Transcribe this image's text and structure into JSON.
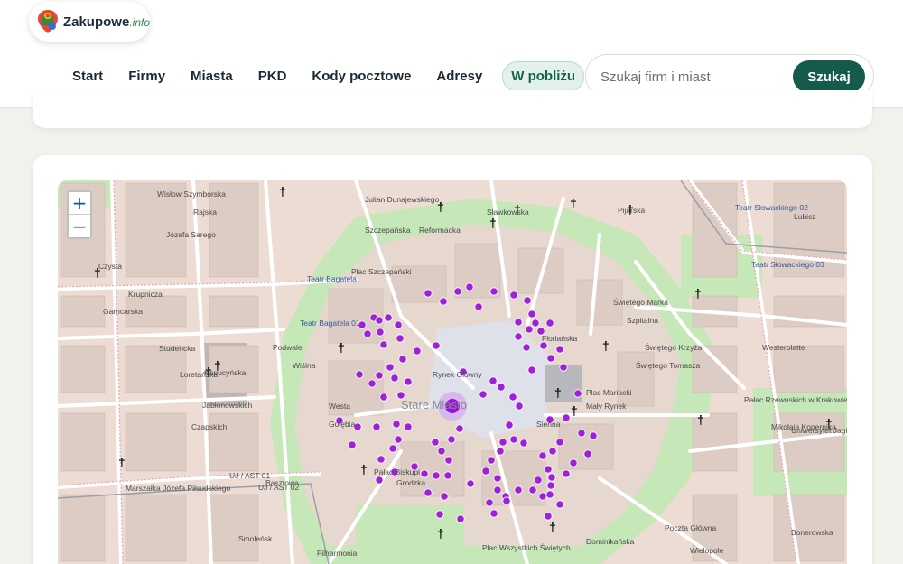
{
  "header": {
    "logo": {
      "brand": "Zakupowe",
      "suffix": ".info"
    },
    "nav": [
      {
        "label": "Start",
        "active": false
      },
      {
        "label": "Firmy",
        "active": false
      },
      {
        "label": "Miasta",
        "active": false
      },
      {
        "label": "PKD",
        "active": false
      },
      {
        "label": "Kody pocztowe",
        "active": false
      },
      {
        "label": "Adresy",
        "active": false
      },
      {
        "label": "W pobliżu",
        "active": true
      }
    ],
    "search": {
      "placeholder": "Szukaj firm i miast",
      "button_label": "Szukaj"
    }
  },
  "map": {
    "zoom_in": "+",
    "zoom_out": "−",
    "center_label": "Stare Miasto",
    "labels": [
      {
        "text": "Teatr Bagatela",
        "color": "blue"
      },
      {
        "text": "Teatr Bagatela 01",
        "color": "blue"
      },
      {
        "text": "Teatr Słowackiego 02",
        "color": "blue"
      },
      {
        "text": "Teatr Słowackiego 03",
        "color": "blue"
      },
      {
        "text": "Pałac Rzewuskich w Krakowie",
        "color": "dark"
      },
      {
        "text": "Uniwersytet Jagielloński Collegium Medicum",
        "color": "dark"
      },
      {
        "text": "Plac Wszystkich Świętych",
        "color": "dark"
      },
      {
        "text": "Pałac Biskupi",
        "color": "dark"
      },
      {
        "text": "Filharmonia",
        "color": "dark"
      },
      {
        "text": "UJ / AST 01",
        "color": "dark"
      },
      {
        "text": "UJ / AST 02",
        "color": "dark"
      },
      {
        "text": "Poczta Główna",
        "color": "dark"
      },
      {
        "text": "Plac Mariacki",
        "color": "dark"
      },
      {
        "text": "Plac Szczepański",
        "color": "dark"
      },
      {
        "text": "Rynek Główny",
        "color": "dark"
      },
      {
        "text": "Czysta",
        "color": "dark"
      },
      {
        "text": "Krupnicza",
        "color": "dark"
      },
      {
        "text": "Studencka",
        "color": "dark"
      },
      {
        "text": "Kapucyńska",
        "color": "dark"
      },
      {
        "text": "Jabłonowskich",
        "color": "dark"
      },
      {
        "text": "Garncarska",
        "color": "dark"
      },
      {
        "text": "Loretańska",
        "color": "dark"
      },
      {
        "text": "Czapskich",
        "color": "dark"
      },
      {
        "text": "Marszałka Józefa Piłsudskiego",
        "color": "dark"
      },
      {
        "text": "Smoleńsk",
        "color": "dark"
      },
      {
        "text": "Podwale",
        "color": "dark"
      },
      {
        "text": "Szczepańska",
        "color": "dark"
      },
      {
        "text": "Sławkowska",
        "color": "dark"
      },
      {
        "text": "Floriańska",
        "color": "dark"
      },
      {
        "text": "Szpitalna",
        "color": "dark"
      },
      {
        "text": "Świętego Tomasza",
        "color": "dark"
      },
      {
        "text": "Świętego Marka",
        "color": "dark"
      },
      {
        "text": "Świętego Krzyża",
        "color": "dark"
      },
      {
        "text": "Reformacka",
        "color": "dark"
      },
      {
        "text": "Pijarska",
        "color": "dark"
      },
      {
        "text": "Lubicz",
        "color": "dark"
      },
      {
        "text": "Westerplatte",
        "color": "dark"
      },
      {
        "text": "Mikołaja Kopernika",
        "color": "dark"
      },
      {
        "text": "Bonerowska",
        "color": "dark"
      },
      {
        "text": "Wielopole",
        "color": "dark"
      },
      {
        "text": "Dominikańska",
        "color": "dark"
      },
      {
        "text": "Rajska",
        "color": "dark"
      },
      {
        "text": "Wiślna",
        "color": "dark"
      },
      {
        "text": "Mały Rynek",
        "color": "dark"
      },
      {
        "text": "Sienna",
        "color": "dark"
      },
      {
        "text": "Grodzka",
        "color": "dark"
      },
      {
        "text": "Gołębia",
        "color": "dark"
      },
      {
        "text": "Basztowa",
        "color": "dark"
      },
      {
        "text": "Julian Dunajewskiego",
        "color": "dark"
      },
      {
        "text": "Wisłow Szymborska",
        "color": "dark"
      },
      {
        "text": "Józefa Sarego",
        "color": "dark"
      },
      {
        "text": "Westa",
        "color": "dark"
      }
    ]
  },
  "colors": {
    "accent": "#145b4c",
    "poi": "#a020d8",
    "park": "#bde6b0",
    "road": "#ffffff",
    "block": "#d9cdc6"
  }
}
